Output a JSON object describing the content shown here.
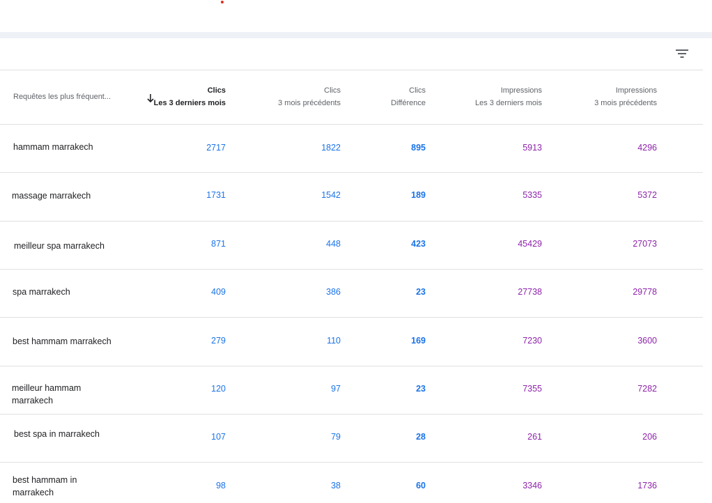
{
  "columns": {
    "query": {
      "label": "Requêtes les plus fréquent..."
    },
    "clicks_current": {
      "line1": "Clics",
      "line2": "Les 3 derniers mois"
    },
    "clicks_previous": {
      "line1": "Clics",
      "line2": "3 mois précédents"
    },
    "clicks_diff": {
      "line1": "Clics",
      "line2": "Différence"
    },
    "impr_current": {
      "line1": "Impressions",
      "line2": "Les 3 derniers mois"
    },
    "impr_previous": {
      "line1": "Impressions",
      "line2": "3 mois précédents"
    }
  },
  "icons": {
    "filter": "filter-icon",
    "sort": "arrow-down-icon"
  },
  "colors": {
    "clicks": "#1a73e8",
    "impressions": "#8e24aa",
    "accent_dot": "#d93025"
  },
  "rows": [
    {
      "query": "hammam marrakech",
      "clicks_current": "2717",
      "clicks_previous": "1822",
      "clicks_diff": "895",
      "impr_current": "5913",
      "impr_previous": "4296"
    },
    {
      "query": "massage marrakech",
      "clicks_current": "1731",
      "clicks_previous": "1542",
      "clicks_diff": "189",
      "impr_current": "5335",
      "impr_previous": "5372"
    },
    {
      "query": "meilleur spa marrakech",
      "clicks_current": "871",
      "clicks_previous": "448",
      "clicks_diff": "423",
      "impr_current": "45429",
      "impr_previous": "27073"
    },
    {
      "query": "spa marrakech",
      "clicks_current": "409",
      "clicks_previous": "386",
      "clicks_diff": "23",
      "impr_current": "27738",
      "impr_previous": "29778"
    },
    {
      "query": "best hammam marrakech",
      "clicks_current": "279",
      "clicks_previous": "110",
      "clicks_diff": "169",
      "impr_current": "7230",
      "impr_previous": "3600"
    },
    {
      "query": "meilleur hammam marrakech",
      "clicks_current": "120",
      "clicks_previous": "97",
      "clicks_diff": "23",
      "impr_current": "7355",
      "impr_previous": "7282"
    },
    {
      "query": "best spa in marrakech",
      "clicks_current": "107",
      "clicks_previous": "79",
      "clicks_diff": "28",
      "impr_current": "261",
      "impr_previous": "206"
    },
    {
      "query": "best hammam in marrakech",
      "clicks_current": "98",
      "clicks_previous": "38",
      "clicks_diff": "60",
      "impr_current": "3346",
      "impr_previous": "1736"
    }
  ]
}
